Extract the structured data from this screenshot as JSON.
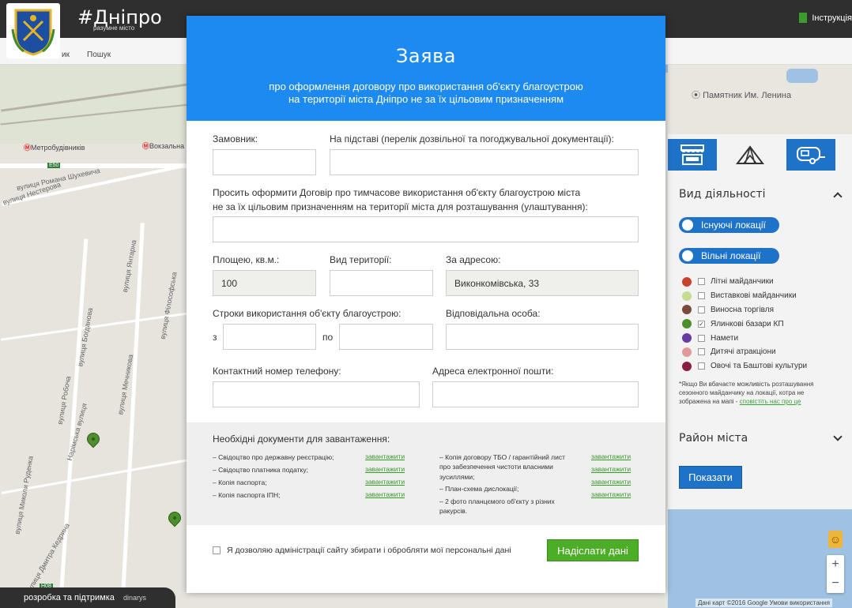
{
  "header": {
    "brand": "#Дніпро",
    "brand_sub": "разумне місто",
    "instructions": "Інструкція"
  },
  "subbar": {
    "left_cut": "ик",
    "search_label": "Пошук"
  },
  "map": {
    "metro_1": "Метробудівників",
    "metro_2": "Вокзальна",
    "labels": [
      "вулиця Романа Шухевича",
      "вулиця Нестерова",
      "вулиця Робоча",
      "вулиця Богданова",
      "вулиця Янтарна",
      "Нарімська вулиця",
      "вулиця Мечникова",
      "вулиця Миколи Руденка",
      "вулиця Філософська",
      "вулиця Дмитра Кедрина"
    ],
    "road_e50": "E50",
    "road_h08": "H08",
    "landmark": "Памятник Им. Ленина",
    "footer": "Дані карт ©2016 Google   Умови використання",
    "zoom_in": "+",
    "zoom_out": "−"
  },
  "credit": {
    "text": "розробка та підтримка",
    "brand": "dinarys"
  },
  "sidebar": {
    "activity_title": "Вид діяльності",
    "toggle_existing": "Існуючі локації",
    "toggle_free": "Вільні локації",
    "categories": [
      {
        "label": "Літні майданчики",
        "color": "#c8432f",
        "checked": false
      },
      {
        "label": "Виставкові майданчики",
        "color": "#c7dc93",
        "checked": false
      },
      {
        "label": "Виносна торгівля",
        "color": "#7b4b3a",
        "checked": false
      },
      {
        "label": "Ялинкові базари КП",
        "color": "#4c8f2c",
        "checked": true
      },
      {
        "label": "Намети",
        "color": "#6a3aa3",
        "checked": false
      },
      {
        "label": "Дитячі атракціони",
        "color": "#e09a9a",
        "checked": false
      },
      {
        "label": "Овочі та Баштові культури",
        "color": "#8a1d3d",
        "checked": false
      }
    ],
    "note_text": "*Якщо Ви вбачаєте можливість розташування сезонного майданчику на локації, котра не зображена на мапі - ",
    "note_link": "сповістіть нас про це",
    "district_title": "Район міста",
    "show_button": "Показати"
  },
  "modal": {
    "title": "Заява",
    "subtitle_1": "про оформлення договору про використання об'єкту благоустрою",
    "subtitle_2": "на території міста Дніпро не за їх цільовим призначенням",
    "customer_label": "Замовник:",
    "basis_label": "На підставі (перелік дозвільної та погоджувальної документації):",
    "request_line_1": "Просить оформити Договір про тимчасове використання об'єкту благоустрою міста",
    "request_line_2": "не за їх цільовим призначенням на території міста для розташування (улаштування):",
    "area_label": "Площею, кв.м.:",
    "area_value": "100",
    "territory_label": "Вид території:",
    "address_label": "За адресою:",
    "address_value": "Виконкомівська, 33",
    "terms_label": "Строки використання об'єкту благоустрою:",
    "from_label": "з",
    "to_label": "по",
    "responsible_label": "Відповідальна особа:",
    "phone_label": "Контактний номер телефону:",
    "email_label": "Адреса електронної пошти:",
    "docs_title": "Необхідні документи для завантаження:",
    "docs_left": [
      "– Свідоцтво про державну реєстрацію;",
      "– Свідоцтво платника податку;",
      "– Копія паспорта;",
      "– Копія паспорта ІПН;"
    ],
    "docs_right": [
      "– Копія договору ТБО / гарантійний лист про забезпечення чистоти власними зусиллями;",
      "– План-схема дислокації;",
      "– 2 фото планцємого об'єкту з різних ракурсів."
    ],
    "download_label": "завантажити",
    "consent_text": "Я дозволяю адміністрації сайту збирати і обробляти мої персональні дані",
    "submit_label": "Надіслати дані"
  }
}
